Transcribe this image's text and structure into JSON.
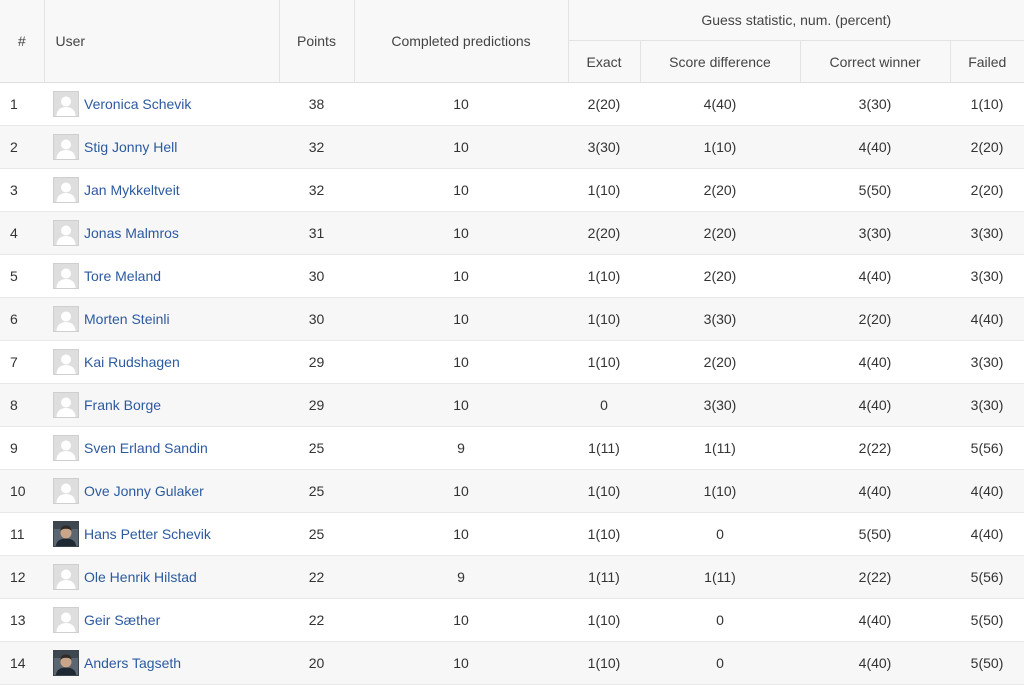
{
  "headers": {
    "rank": "#",
    "user": "User",
    "points": "Points",
    "completed": "Completed predictions",
    "group": "Guess statistic, num. (percent)",
    "exact": "Exact",
    "score_diff": "Score difference",
    "correct_winner": "Correct winner",
    "failed": "Failed"
  },
  "rows": [
    {
      "rank": "1",
      "name": "Veronica Schevik",
      "avatar": "default-avatar",
      "points": "38",
      "completed": "10",
      "exact": "2(20)",
      "score_diff": "4(40)",
      "correct_winner": "3(30)",
      "failed": "1(10)"
    },
    {
      "rank": "2",
      "name": "Stig Jonny Hell",
      "avatar": "default-avatar",
      "points": "32",
      "completed": "10",
      "exact": "3(30)",
      "score_diff": "1(10)",
      "correct_winner": "4(40)",
      "failed": "2(20)"
    },
    {
      "rank": "3",
      "name": "Jan Mykkeltveit",
      "avatar": "default-avatar",
      "points": "32",
      "completed": "10",
      "exact": "1(10)",
      "score_diff": "2(20)",
      "correct_winner": "5(50)",
      "failed": "2(20)"
    },
    {
      "rank": "4",
      "name": "Jonas Malmros",
      "avatar": "default-avatar",
      "points": "31",
      "completed": "10",
      "exact": "2(20)",
      "score_diff": "2(20)",
      "correct_winner": "3(30)",
      "failed": "3(30)"
    },
    {
      "rank": "5",
      "name": "Tore Meland",
      "avatar": "default-avatar",
      "points": "30",
      "completed": "10",
      "exact": "1(10)",
      "score_diff": "2(20)",
      "correct_winner": "4(40)",
      "failed": "3(30)"
    },
    {
      "rank": "6",
      "name": "Morten Steinli",
      "avatar": "default-avatar",
      "points": "30",
      "completed": "10",
      "exact": "1(10)",
      "score_diff": "3(30)",
      "correct_winner": "2(20)",
      "failed": "4(40)"
    },
    {
      "rank": "7",
      "name": "Kai Rudshagen",
      "avatar": "default-avatar",
      "points": "29",
      "completed": "10",
      "exact": "1(10)",
      "score_diff": "2(20)",
      "correct_winner": "4(40)",
      "failed": "3(30)"
    },
    {
      "rank": "8",
      "name": "Frank Borge",
      "avatar": "default-avatar",
      "points": "29",
      "completed": "10",
      "exact": "0",
      "score_diff": "3(30)",
      "correct_winner": "4(40)",
      "failed": "3(30)"
    },
    {
      "rank": "9",
      "name": "Sven Erland Sandin",
      "avatar": "default-avatar",
      "points": "25",
      "completed": "9",
      "exact": "1(11)",
      "score_diff": "1(11)",
      "correct_winner": "2(22)",
      "failed": "5(56)"
    },
    {
      "rank": "10",
      "name": "Ove Jonny Gulaker",
      "avatar": "default-avatar",
      "points": "25",
      "completed": "10",
      "exact": "1(10)",
      "score_diff": "1(10)",
      "correct_winner": "4(40)",
      "failed": "4(40)"
    },
    {
      "rank": "11",
      "name": "Hans Petter Schevik",
      "avatar": "photo-avatar",
      "points": "25",
      "completed": "10",
      "exact": "1(10)",
      "score_diff": "0",
      "correct_winner": "5(50)",
      "failed": "4(40)"
    },
    {
      "rank": "12",
      "name": "Ole Henrik Hilstad",
      "avatar": "default-avatar",
      "points": "22",
      "completed": "9",
      "exact": "1(11)",
      "score_diff": "1(11)",
      "correct_winner": "2(22)",
      "failed": "5(56)"
    },
    {
      "rank": "13",
      "name": "Geir Sæther",
      "avatar": "default-avatar",
      "points": "22",
      "completed": "10",
      "exact": "1(10)",
      "score_diff": "0",
      "correct_winner": "4(40)",
      "failed": "5(50)"
    },
    {
      "rank": "14",
      "name": "Anders Tagseth",
      "avatar": "photo-avatar",
      "points": "20",
      "completed": "10",
      "exact": "1(10)",
      "score_diff": "0",
      "correct_winner": "4(40)",
      "failed": "5(50)"
    }
  ],
  "colors": {
    "link": "#2c5aa0",
    "header_bg": "#f8f8f8",
    "stripe_bg": "#f7f7f7"
  }
}
